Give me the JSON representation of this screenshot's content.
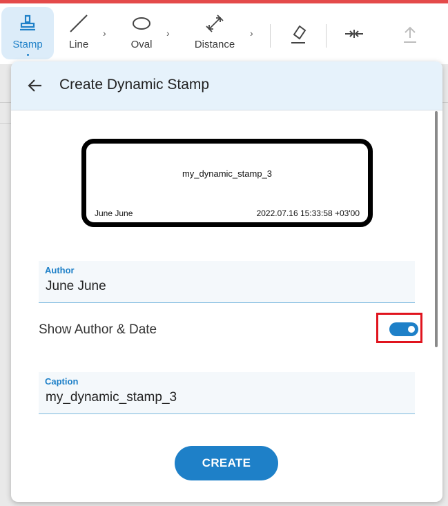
{
  "toolbar": {
    "tools": [
      {
        "label": "Stamp",
        "icon": "stamp-icon",
        "active": true
      },
      {
        "label": "Line",
        "icon": "line-icon"
      },
      {
        "label": "Oval",
        "icon": "oval-icon"
      },
      {
        "label": "Distance",
        "icon": "distance-icon"
      }
    ],
    "extra_icons": [
      "eraser-icon",
      "compare-icon",
      "upload-icon"
    ],
    "accent": "#1e80c8"
  },
  "dialog": {
    "title": "Create Dynamic Stamp",
    "preview": {
      "caption": "my_dynamic_stamp_3",
      "author": "June June",
      "date": "2022.07.16 15:33:58 +03'00"
    },
    "author_field": {
      "label": "Author",
      "value": "June June"
    },
    "show_author_date": {
      "label": "Show Author & Date",
      "enabled": true
    },
    "caption_field": {
      "label": "Caption",
      "value": "my_dynamic_stamp_3"
    },
    "create_label": "CREATE"
  }
}
